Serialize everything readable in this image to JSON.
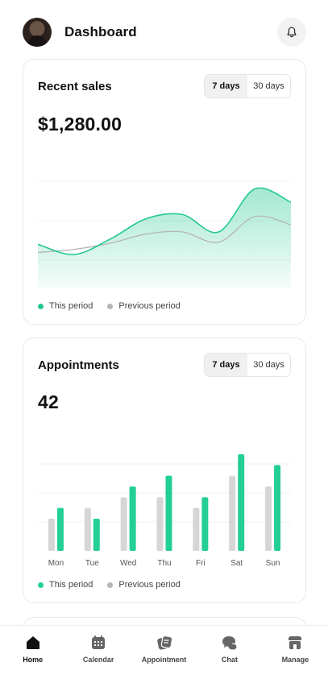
{
  "header": {
    "title": "Dashboard"
  },
  "recent_sales": {
    "title": "Recent sales",
    "ranges": [
      "7 days",
      "30 days"
    ],
    "active_range": "7 days",
    "total": "$1,280.00",
    "legend": [
      "This period",
      "Previous period"
    ],
    "colors": {
      "current": "#23c98f",
      "previous": "#b5b5b5"
    }
  },
  "appointments": {
    "title": "Appointments",
    "ranges": [
      "7 days",
      "30 days"
    ],
    "active_range": "7 days",
    "total": "42",
    "legend": [
      "This period",
      "Previous period"
    ],
    "colors": {
      "current": "#23cf93",
      "previous": "#d6d6d6"
    }
  },
  "chart_data": [
    {
      "type": "area",
      "title": "Recent sales",
      "x": [
        0,
        1,
        2,
        3,
        4,
        5,
        6,
        7
      ],
      "series": [
        {
          "name": "This period",
          "values": [
            0.43,
            0.33,
            0.48,
            0.68,
            0.72,
            0.55,
            0.97,
            0.84
          ]
        },
        {
          "name": "Previous period",
          "values": [
            0.35,
            0.38,
            0.44,
            0.53,
            0.55,
            0.45,
            0.7,
            0.62
          ]
        }
      ],
      "ylim": [
        0,
        1.1
      ],
      "grid": true,
      "legend": "bottom-left"
    },
    {
      "type": "bar",
      "title": "Appointments",
      "categories": [
        "Mon",
        "Tue",
        "Wed",
        "Thu",
        "Fri",
        "Sat",
        "Sun"
      ],
      "series": [
        {
          "name": "Previous period",
          "values": [
            3,
            4,
            5,
            5,
            4,
            7,
            6
          ]
        },
        {
          "name": "This period",
          "values": [
            4,
            3,
            6,
            7,
            5,
            9,
            8
          ]
        }
      ],
      "ylim": [
        0,
        9
      ],
      "grid": true,
      "legend": "bottom-left"
    }
  ],
  "tabbar": {
    "items": [
      {
        "label": "Home",
        "icon": "home-icon",
        "active": true
      },
      {
        "label": "Calendar",
        "icon": "calendar-icon",
        "active": false
      },
      {
        "label": "Appointment",
        "icon": "appointment-icon",
        "active": false
      },
      {
        "label": "Chat",
        "icon": "chat-icon",
        "active": false
      },
      {
        "label": "Manage",
        "icon": "manage-icon",
        "active": false
      }
    ]
  }
}
